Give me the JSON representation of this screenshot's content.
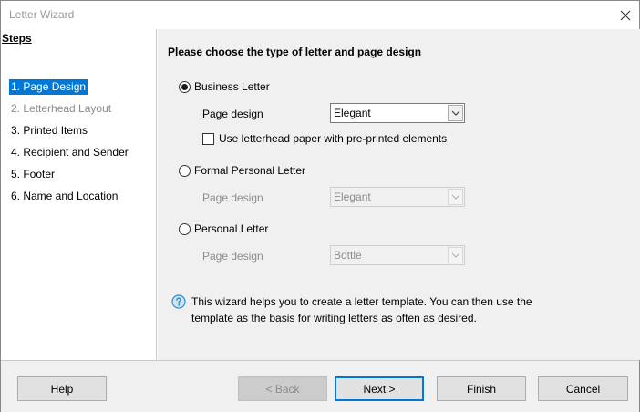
{
  "window": {
    "title": "Letter Wizard"
  },
  "steps": {
    "header": "Steps",
    "items": [
      {
        "label": "1. Page Design",
        "state": "active"
      },
      {
        "label": "2. Letterhead Layout",
        "state": "disabled"
      },
      {
        "label": "3. Printed Items",
        "state": "normal"
      },
      {
        "label": "4. Recipient and Sender",
        "state": "normal"
      },
      {
        "label": "5. Footer",
        "state": "normal"
      },
      {
        "label": "6. Name and Location",
        "state": "normal"
      }
    ]
  },
  "content": {
    "title": "Please choose the type of letter and page design",
    "business": {
      "label": "Business Letter",
      "checked": true,
      "page_design_label": "Page design",
      "page_design_value": "Elegant",
      "letterhead_label": "Use letterhead paper with pre-printed elements",
      "letterhead_checked": false
    },
    "formal": {
      "label": "Formal Personal Letter",
      "checked": false,
      "page_design_label": "Page design",
      "page_design_value": "Elegant"
    },
    "personal": {
      "label": "Personal Letter",
      "checked": false,
      "page_design_label": "Page design",
      "page_design_value": "Bottle"
    },
    "info": "This wizard helps you to create a letter template. You can then use the template as the basis for writing letters as often as desired."
  },
  "buttons": {
    "help": "Help",
    "back": "< Back",
    "next": "Next >",
    "finish": "Finish",
    "cancel": "Cancel"
  },
  "colors": {
    "accent": "#0078d7",
    "panel_bg": "#f0f0f0",
    "info_icon": "#2e8bcf"
  },
  "icons": {
    "close": "close-icon",
    "info": "info-icon",
    "dropdown": "chevron-down-icon"
  }
}
